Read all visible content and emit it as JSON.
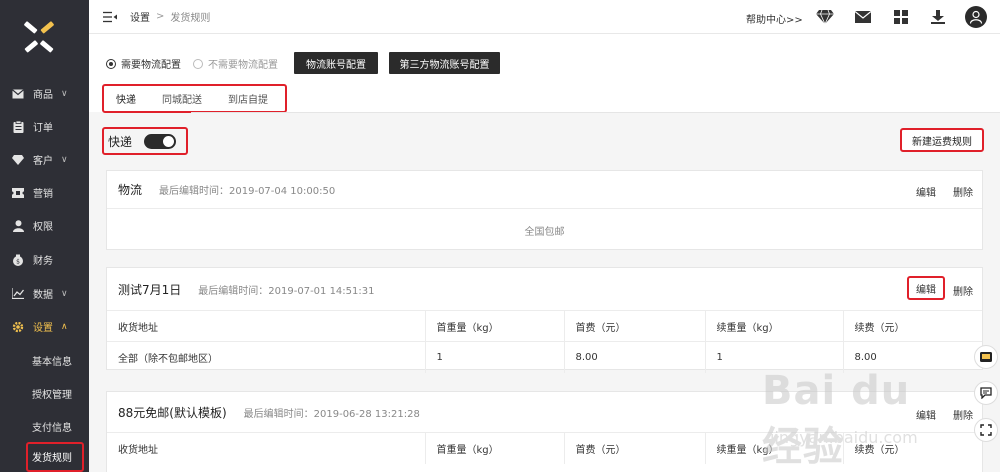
{
  "sidebar": {
    "items": [
      {
        "label": "商品",
        "icon": "mail-icon",
        "chevron": "∨"
      },
      {
        "label": "订单",
        "icon": "clipboard-icon",
        "chevron": ""
      },
      {
        "label": "客户",
        "icon": "diamond-icon",
        "chevron": "∨"
      },
      {
        "label": "营销",
        "icon": "ticket-icon",
        "chevron": ""
      },
      {
        "label": "权限",
        "icon": "user-icon",
        "chevron": ""
      },
      {
        "label": "财务",
        "icon": "moneybag-icon",
        "chevron": ""
      },
      {
        "label": "数据",
        "icon": "chart-icon",
        "chevron": "∨"
      },
      {
        "label": "设置",
        "icon": "gear-icon",
        "chevron": "∧"
      }
    ],
    "sub_items": [
      {
        "label": "基本信息"
      },
      {
        "label": "授权管理"
      },
      {
        "label": "支付信息"
      },
      {
        "label": "发货规则"
      }
    ]
  },
  "header": {
    "breadcrumb_root": "设置",
    "breadcrumb_sep": ">",
    "breadcrumb_current": "发货规则",
    "help": "帮助中心>>"
  },
  "config": {
    "radio_need": "需要物流配置",
    "radio_no_need": "不需要物流配置",
    "btn_logistics_account": "物流账号配置",
    "btn_third_party_account": "第三方物流账号配置"
  },
  "tabs": [
    "快递",
    "同城配送",
    "到店自提"
  ],
  "express": {
    "label": "快递",
    "toggle_on": true,
    "new_rule": "新建运费规则"
  },
  "cards": [
    {
      "title": "物流",
      "meta": "最后编辑时间：2019-07-04 10:00:50",
      "edit": "编辑",
      "delete": "删除",
      "free_text": "全国包邮"
    },
    {
      "title": "测试7月1日",
      "meta": "最后编辑时间：2019-07-01 14:51:31",
      "edit": "编辑",
      "delete": "删除",
      "columns": [
        "收货地址",
        "首重量（kg）",
        "首费（元）",
        "续重量（kg）",
        "续费（元）"
      ],
      "rows": [
        [
          "全部（除不包邮地区）",
          "1",
          "8.00",
          "1",
          "8.00"
        ]
      ]
    },
    {
      "title": "88元免邮(默认模板)",
      "meta": "最后编辑时间：2019-06-28 13:21:28",
      "edit": "编辑",
      "delete": "删除",
      "columns": [
        "收货地址",
        "首重量（kg）",
        "首费（元）",
        "续重量（kg）",
        "续费（元）"
      ]
    }
  ],
  "watermark": {
    "logo": "Bai du 经验",
    "url": "jingyan.baidu.com"
  },
  "colors": {
    "sidebar_bg": "#2e2f36",
    "active_nav": "#f2c14e",
    "highlight_red": "#e0202a",
    "dark_button": "#2b2b2b"
  }
}
